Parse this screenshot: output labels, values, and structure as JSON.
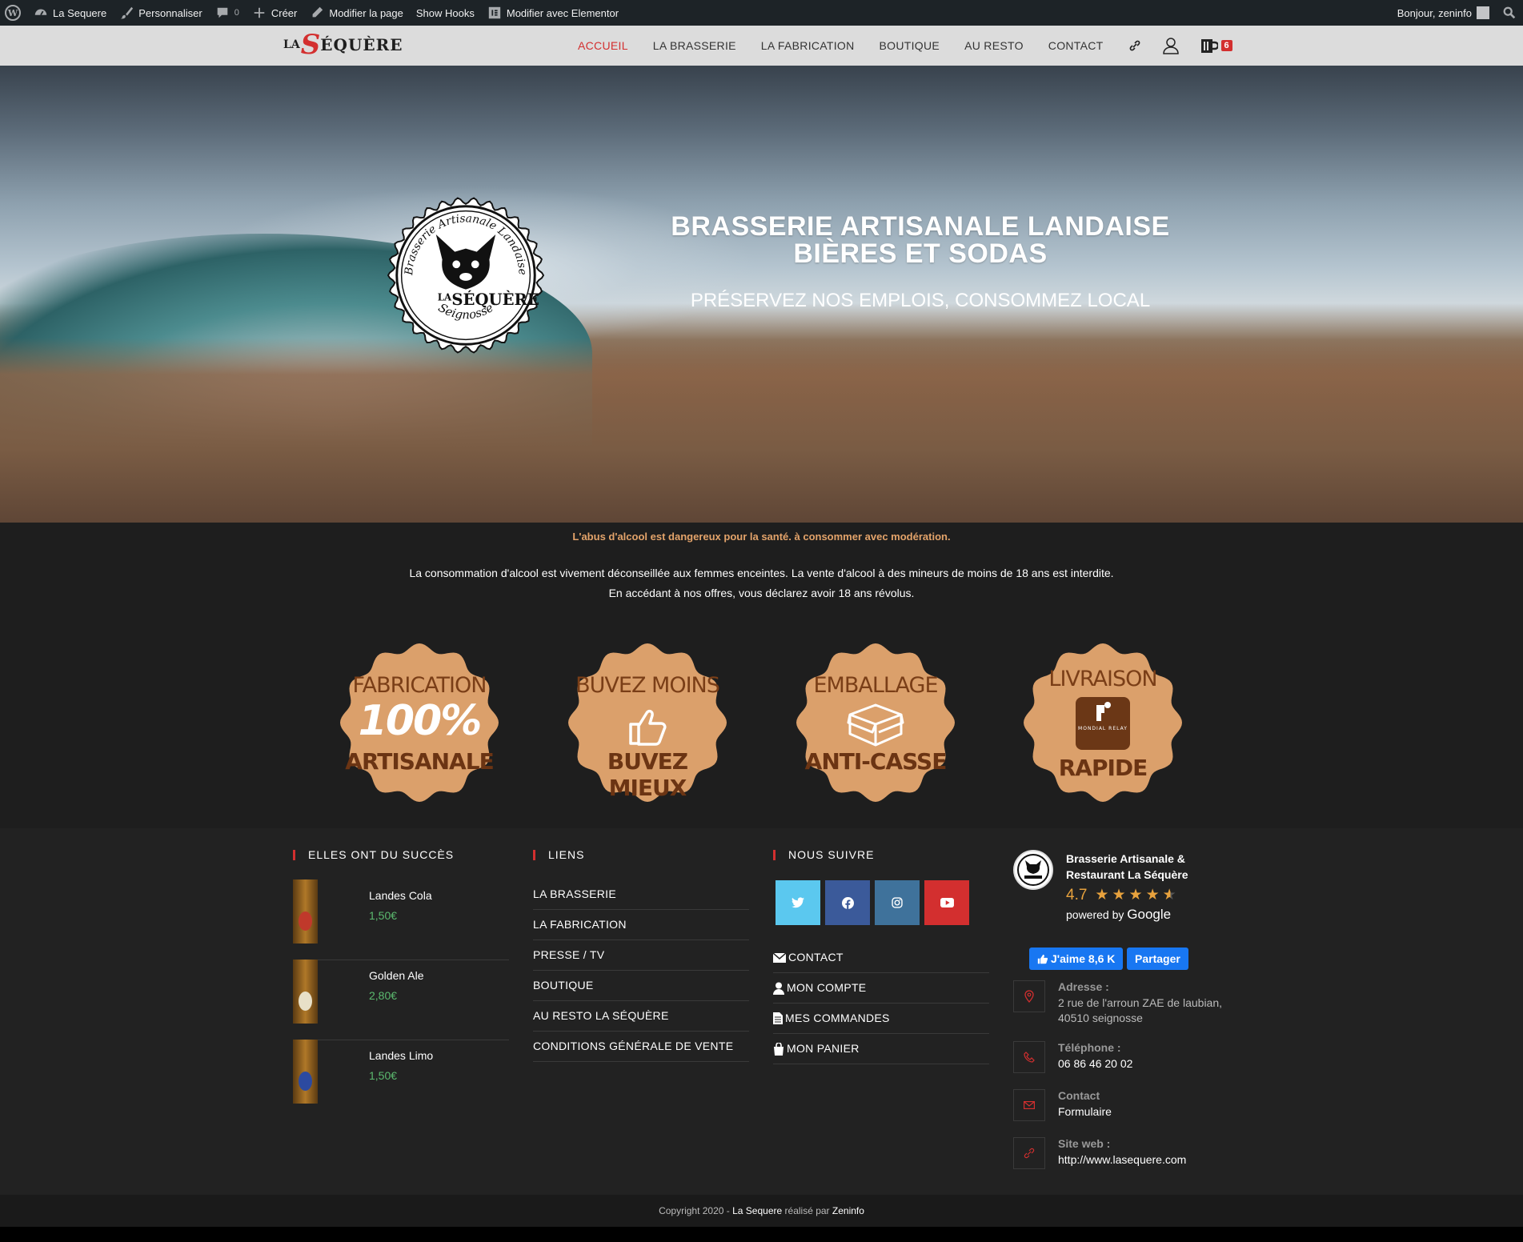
{
  "admin_bar": {
    "site_name": "La Sequere",
    "customize": "Personnaliser",
    "comments_count": "0",
    "new": "Créer",
    "edit_page": "Modifier la page",
    "show_hooks": "Show Hooks",
    "edit_elementor": "Modifier avec Elementor",
    "greeting": "Bonjour, zeninfo"
  },
  "header": {
    "logo_la": "LA",
    "logo_s": "S",
    "logo_rest": "ÉQUÈRE",
    "nav": [
      "ACCUEIL",
      "LA BRASSERIE",
      "LA FABRICATION",
      "BOUTIQUE",
      "AU RESTO",
      "CONTACT"
    ],
    "active_nav": "ACCUEIL",
    "cart_count": "6"
  },
  "hero": {
    "badge_arc_text": "Brasserie Artisanale Landaise",
    "badge_name_la": "LA",
    "badge_name": "SÉQUÈRE",
    "badge_city": "Seignosse",
    "title_line1": "BRASSERIE ARTISANALE LANDAISE",
    "title_line2": "BIÈRES ET SODAS",
    "subtitle": "PRÉSERVEZ NOS EMPLOIS, CONSOMMEZ LOCAL"
  },
  "warning": {
    "main": "L'abus d'alcool est dangereux pour la santé. à consommer avec modération.",
    "line1": "La consommation d'alcool est vivement déconseillée aux femmes enceintes. La vente d'alcool à des mineurs de moins de 18 ans est interdite.",
    "line2": "En accédant à nos offres, vous déclarez avoir 18 ans révolus."
  },
  "badges": [
    {
      "top": "FABRICATION",
      "middle": "100%",
      "bottom": "ARTISANALE",
      "icon": "percent"
    },
    {
      "top": "BUVEZ MOINS",
      "middle": "",
      "bottom": "BUVEZ MIEUX",
      "icon": "thumbs-up-icon"
    },
    {
      "top": "EMBALLAGE",
      "middle": "",
      "bottom": "ANTI-CASSE",
      "icon": "box-icon"
    },
    {
      "top": "LIVRAISON",
      "middle": "MONDIAL RELAY",
      "bottom": "RAPIDE",
      "icon": "mondial-relay-logo"
    }
  ],
  "footer": {
    "col1_title": "ELLES ONT DU SUCCÈS",
    "products": [
      {
        "name": "Landes Cola",
        "price": "1,50€",
        "label_color": "#c0392b"
      },
      {
        "name": "Golden Ale",
        "price": "2,80€",
        "label_color": "#e8e0c8"
      },
      {
        "name": "Landes Limo",
        "price": "1,50€",
        "label_color": "#2c4aa0"
      }
    ],
    "col2_title": "LIENS",
    "links": [
      "LA BRASSERIE",
      "LA FABRICATION",
      "PRESSE / TV",
      "BOUTIQUE",
      "AU RESTO LA SÉQUÈRE",
      "CONDITIONS GÉNÉRALE DE VENTE"
    ],
    "col3_title": "NOUS SUIVRE",
    "socials": [
      {
        "name": "twitter-icon",
        "color": "#5bc8ef"
      },
      {
        "name": "facebook-icon",
        "color": "#3b5a9a"
      },
      {
        "name": "instagram-icon",
        "color": "#3f729b"
      },
      {
        "name": "youtube-icon",
        "color": "#d32f2f"
      }
    ],
    "account_links": [
      "CONTACT",
      "MON COMPTE",
      "MES COMMANDES",
      "MON PANIER"
    ],
    "google": {
      "name": "Brasserie Artisanale & Restaurant La Séquère",
      "rating": "4.7",
      "powered": "powered by",
      "google": "Google"
    },
    "fb_like": "J'aime 8,6 K",
    "fb_share": "Partager",
    "contact": {
      "address_label": "Adresse :",
      "address_line1": "2 rue de l'arroun ZAE de laubian,",
      "address_line2": "40510 seignosse",
      "phone_label": "Téléphone :",
      "phone": "06 86 46 20 02",
      "contact_label": "Contact",
      "contact_value": "Formulaire",
      "site_label": "Site web :",
      "site": "http://www.lasequere.com"
    }
  },
  "copyright": {
    "prefix": "Copyright 2020 - ",
    "site": "La Sequere",
    "middle": " réalisé par ",
    "author": "Zeninfo"
  },
  "colors": {
    "accent": "#d32f2f",
    "badge": "#dba06b",
    "price": "#5bba6f",
    "warning": "#e3a36a"
  }
}
